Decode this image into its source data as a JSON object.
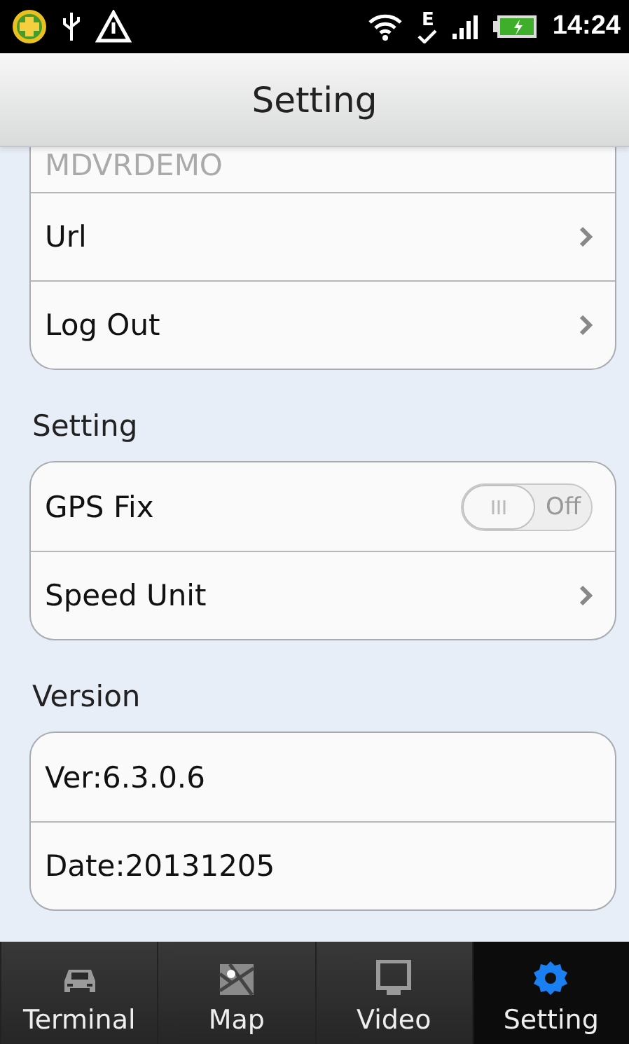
{
  "status_bar": {
    "network_type": "E",
    "time": "14:24"
  },
  "title": "Setting",
  "sections": [
    {
      "rows": [
        {
          "kind": "muted",
          "label": "MDVRDEMO"
        },
        {
          "kind": "link",
          "label": "Url"
        },
        {
          "kind": "link",
          "label": "Log Out"
        }
      ]
    },
    {
      "header": "Setting",
      "rows": [
        {
          "kind": "toggle",
          "label": "GPS Fix",
          "on": false,
          "state_text": "Off"
        },
        {
          "kind": "link",
          "label": "Speed Unit"
        }
      ]
    },
    {
      "header": "Version",
      "rows": [
        {
          "kind": "info",
          "label": "Ver:6.3.0.6"
        },
        {
          "kind": "info",
          "label": "Date:20131205"
        }
      ]
    }
  ],
  "tabs": [
    {
      "label": "Terminal",
      "selected": false
    },
    {
      "label": "Map",
      "selected": false
    },
    {
      "label": "Video",
      "selected": false
    },
    {
      "label": "Setting",
      "selected": true
    }
  ]
}
